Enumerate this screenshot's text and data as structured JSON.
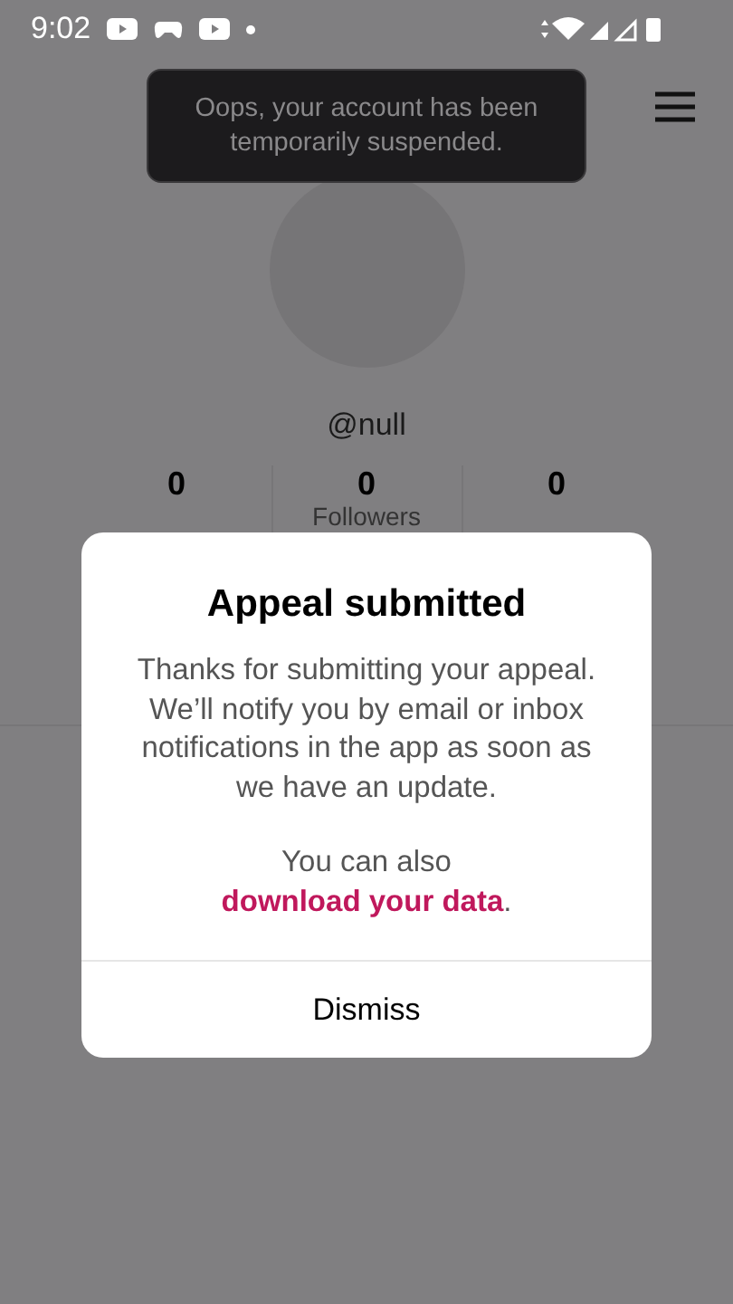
{
  "status_bar": {
    "time": "9:02"
  },
  "toast": {
    "text": "Oops, your account has been temporarily suspended."
  },
  "profile": {
    "username": "@null",
    "stats": [
      {
        "count": "0"
      },
      {
        "count": "0",
        "label": "Followers"
      },
      {
        "count": "0"
      }
    ]
  },
  "dialog": {
    "title": "Appeal submitted",
    "body": "Thanks for submitting your appeal. We’ll notify you by email or inbox notifications in the app as soon as we have an update.",
    "note_prefix": "You can also ",
    "link": "download your data",
    "note_suffix": ".",
    "button": "Dismiss"
  }
}
